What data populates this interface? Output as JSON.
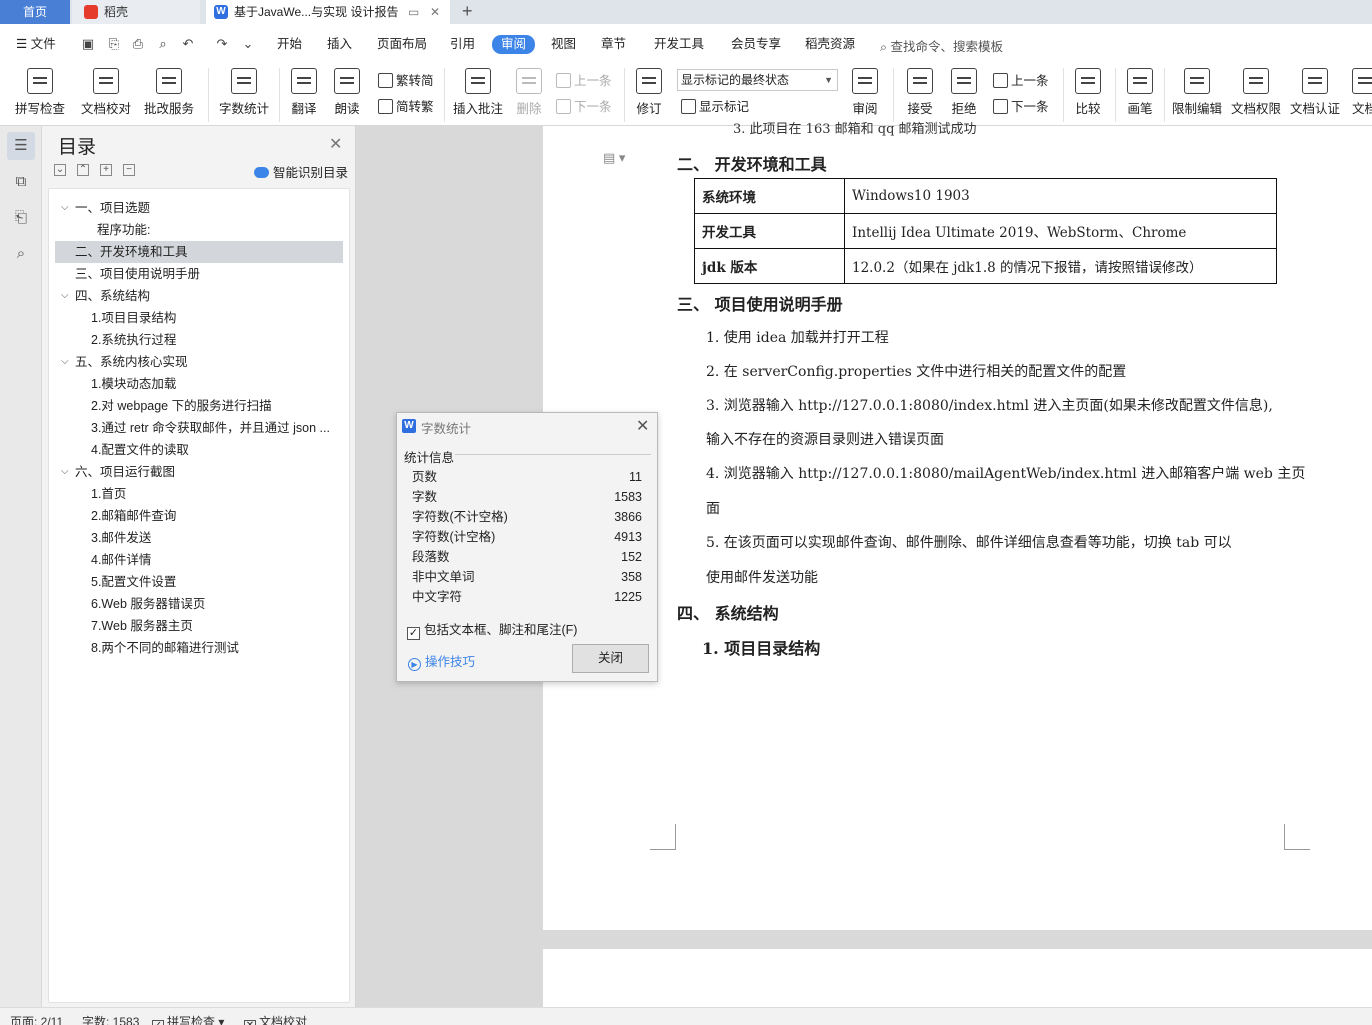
{
  "tabs": {
    "home": "首页",
    "docer": "稻壳",
    "document": "基于JavaWe...与实现 设计报告",
    "doc_icon": "W"
  },
  "menu": {
    "file": "文件",
    "items": [
      "开始",
      "插入",
      "页面布局",
      "引用",
      "审阅",
      "视图",
      "章节",
      "开发工具",
      "会员专享",
      "稻壳资源"
    ],
    "active": "审阅",
    "search": "查找命令、搜索模板"
  },
  "ribbon": {
    "spellcheck": "拼写检查",
    "proofread": "文档校对",
    "batch_service": "批改服务",
    "word_count": "字数统计",
    "translate": "翻译",
    "read_aloud": "朗读",
    "trad_to_simp": "繁转简",
    "simp_to_trad": "简转繁",
    "insert_comment": "插入批注",
    "delete": "删除",
    "prev_comment": "上一条",
    "next_comment": "下一条",
    "track_changes": "修订",
    "markup_state": "显示标记的最终状态",
    "show_markup": "显示标记",
    "review": "审阅",
    "accept": "接受",
    "reject": "拒绝",
    "prev_change": "上一条",
    "next_change": "下一条",
    "compare": "比较",
    "ink": "画笔",
    "restrict_edit": "限制编辑",
    "doc_permission": "文档权限",
    "doc_certify": "文档认证",
    "doc_more": "文档"
  },
  "toc": {
    "title": "目录",
    "smart_toc": "智能识别目录",
    "items": [
      {
        "label": "一、项目选题",
        "chev": "v"
      },
      {
        "label": "程序功能:",
        "chev": ""
      },
      {
        "label": "二、开发环境和工具",
        "chev": ""
      },
      {
        "label": "三、项目使用说明手册",
        "chev": ""
      },
      {
        "label": "四、系统结构",
        "chev": "v"
      },
      {
        "label": "1.项目目录结构",
        "chev": ""
      },
      {
        "label": "2.系统执行过程",
        "chev": ""
      },
      {
        "label": "五、系统内核心实现",
        "chev": "v"
      },
      {
        "label": "1.模块动态加载",
        "chev": ""
      },
      {
        "label": "2.对 webpage 下的服务进行扫描",
        "chev": ""
      },
      {
        "label": "3.通过 retr 命令获取邮件，并且通过 json ...",
        "chev": ""
      },
      {
        "label": "4.配置文件的读取",
        "chev": ""
      },
      {
        "label": "六、项目运行截图",
        "chev": "v"
      },
      {
        "label": "1.首页",
        "chev": ""
      },
      {
        "label": "2.邮箱邮件查询",
        "chev": ""
      },
      {
        "label": "3.邮件发送",
        "chev": ""
      },
      {
        "label": "4.邮件详情",
        "chev": ""
      },
      {
        "label": "5.配置文件设置",
        "chev": ""
      },
      {
        "label": "6.Web 服务器错误页",
        "chev": ""
      },
      {
        "label": "7.Web 服务器主页",
        "chev": ""
      },
      {
        "label": "8.两个不同的邮箱进行测试",
        "chev": ""
      }
    ],
    "selected_index": 2
  },
  "document": {
    "cut_line": "3.  此项目在 163 邮箱和 qq 邮箱测试成功",
    "h2": "二、      开发环境和工具",
    "table": [
      {
        "k": "系统环境",
        "v": "Windows10 1903"
      },
      {
        "k": "开发工具",
        "v": "Intellij Idea Ultimate 2019、WebStorm、Chrome"
      },
      {
        "k": "jdk 版本",
        "v": "12.0.2（如果在 jdk1.8 的情况下报错，请按照错误修改）"
      }
    ],
    "h3": "三、      项目使用说明手册",
    "steps": [
      "1.     使用 idea 加载并打开工程",
      "2.     在 serverConfig.properties 文件中进行相关的配置文件的配置",
      "3.     浏览器输入 http://127.0.0.1:8080/index.html 进入主页面(如果未修改配置文件信息),",
      "        输入不存在的资源目录则进入错误页面",
      "4.     浏览器输入 http://127.0.0.1:8080/mailAgentWeb/index.html 进入邮箱客户端 web 主页",
      "        面",
      "5.     在该页面可以实现邮件查询、邮件删除、邮件详细信息查看等功能，切换 tab 可以",
      "        使用邮件发送功能"
    ],
    "h4": "四、      系统结构",
    "h4_1": "1.   项目目录结构"
  },
  "word_count": {
    "title": "字数统计",
    "logo": "W",
    "section": "统计信息",
    "rows": [
      {
        "label": "页数",
        "value": "11"
      },
      {
        "label": "字数",
        "value": "1583"
      },
      {
        "label": "字符数(不计空格)",
        "value": "3866"
      },
      {
        "label": "字符数(计空格)",
        "value": "4913"
      },
      {
        "label": "段落数",
        "value": "152"
      },
      {
        "label": "非中文单词",
        "value": "358"
      },
      {
        "label": "中文字符",
        "value": "1225"
      }
    ],
    "include_label": "包括文本框、脚注和尾注(F)",
    "include_checked": true,
    "tips": "操作技巧",
    "close": "关闭"
  },
  "status": {
    "page": "页面: 2/11",
    "words": "字数: 1583",
    "spell": "拼写检查",
    "proof": "文档校对"
  },
  "colors": {
    "accent": "#3d84e8",
    "home_tab": "#4a7fd6"
  }
}
